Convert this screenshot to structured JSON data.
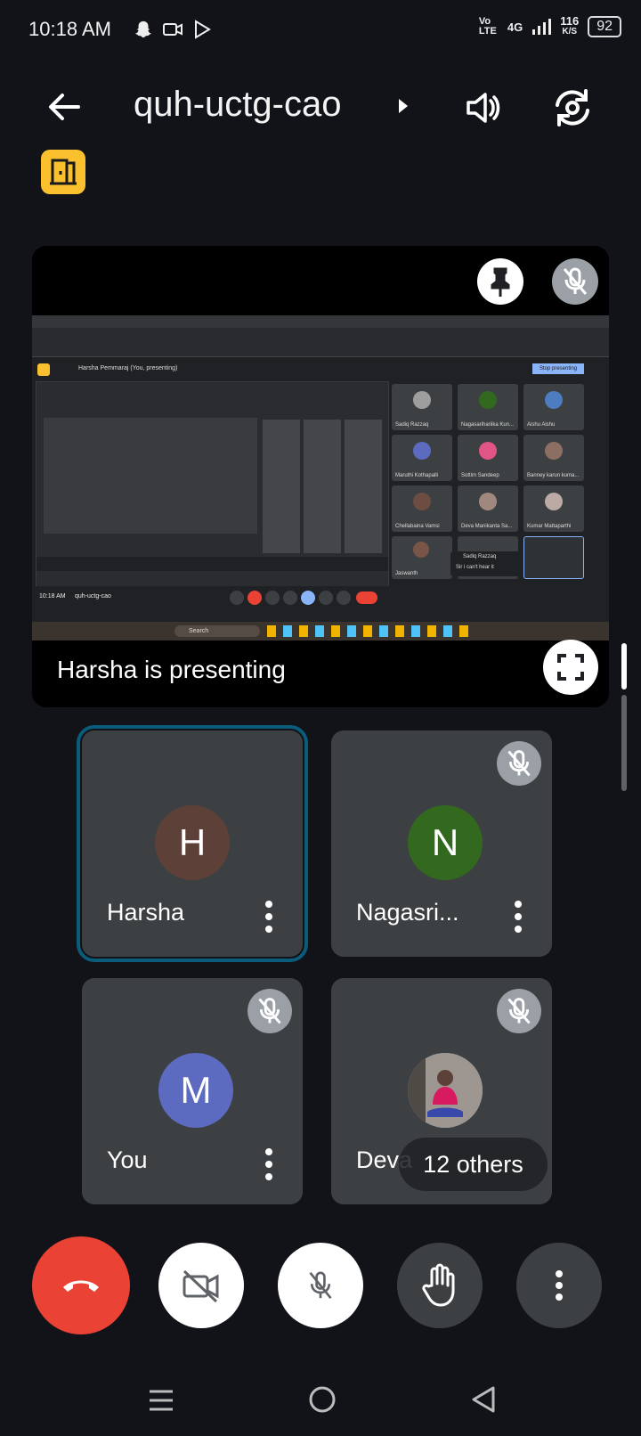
{
  "status_bar": {
    "time": "10:18 AM",
    "network_type": "Vo LTE",
    "signal": "4G",
    "speed_value": "116",
    "speed_unit": "K/S",
    "battery": "92"
  },
  "header": {
    "meeting_code": "quh-uctg-cao"
  },
  "presentation": {
    "label": "Harsha is presenting",
    "shared_window_title": "Harsha Pemmaraj (You, presenting)",
    "stop_button": "Stop presenting",
    "bottom_time": "10:18 AM",
    "bottom_code": "quh-uctg-cao",
    "search_placeholder": "Search",
    "inner_names": [
      "Sadiq Razzaq",
      "Nagasarihariika Kun...",
      "Aishu Aishu",
      "Maruthi Kothapalli",
      "Sottim Sandeep",
      "Banney karun kuma...",
      "Chellabaina Vamsi",
      "Deva Manikanta Sa...",
      "Kumar Mattaparthi",
      "Jaswanth"
    ],
    "chat_name": "Sadiq Razzaq",
    "chat_text": "Sir i can't hear it"
  },
  "participants": [
    {
      "name": "Harsha",
      "initial": "H",
      "color": "#5d4037"
    },
    {
      "name": "Nagasri...",
      "initial": "N",
      "color": "#33691e"
    },
    {
      "name": "You",
      "initial": "M",
      "color": "#5c6bc0"
    },
    {
      "name": "Deva",
      "initial": "",
      "color": "#777777"
    }
  ],
  "others_count": "12 others",
  "colors": {
    "end_call": "#ea4335",
    "active_border": "#0b5b7a",
    "badge": "#fbc02d"
  },
  "icons": [
    "back-arrow-icon",
    "chevron-right-icon",
    "speaker-icon",
    "camera-flip-icon",
    "door-icon",
    "pin-icon",
    "mic-off-icon",
    "fullscreen-icon",
    "more-vert-icon",
    "end-call-icon",
    "video-off-icon",
    "raise-hand-icon"
  ]
}
